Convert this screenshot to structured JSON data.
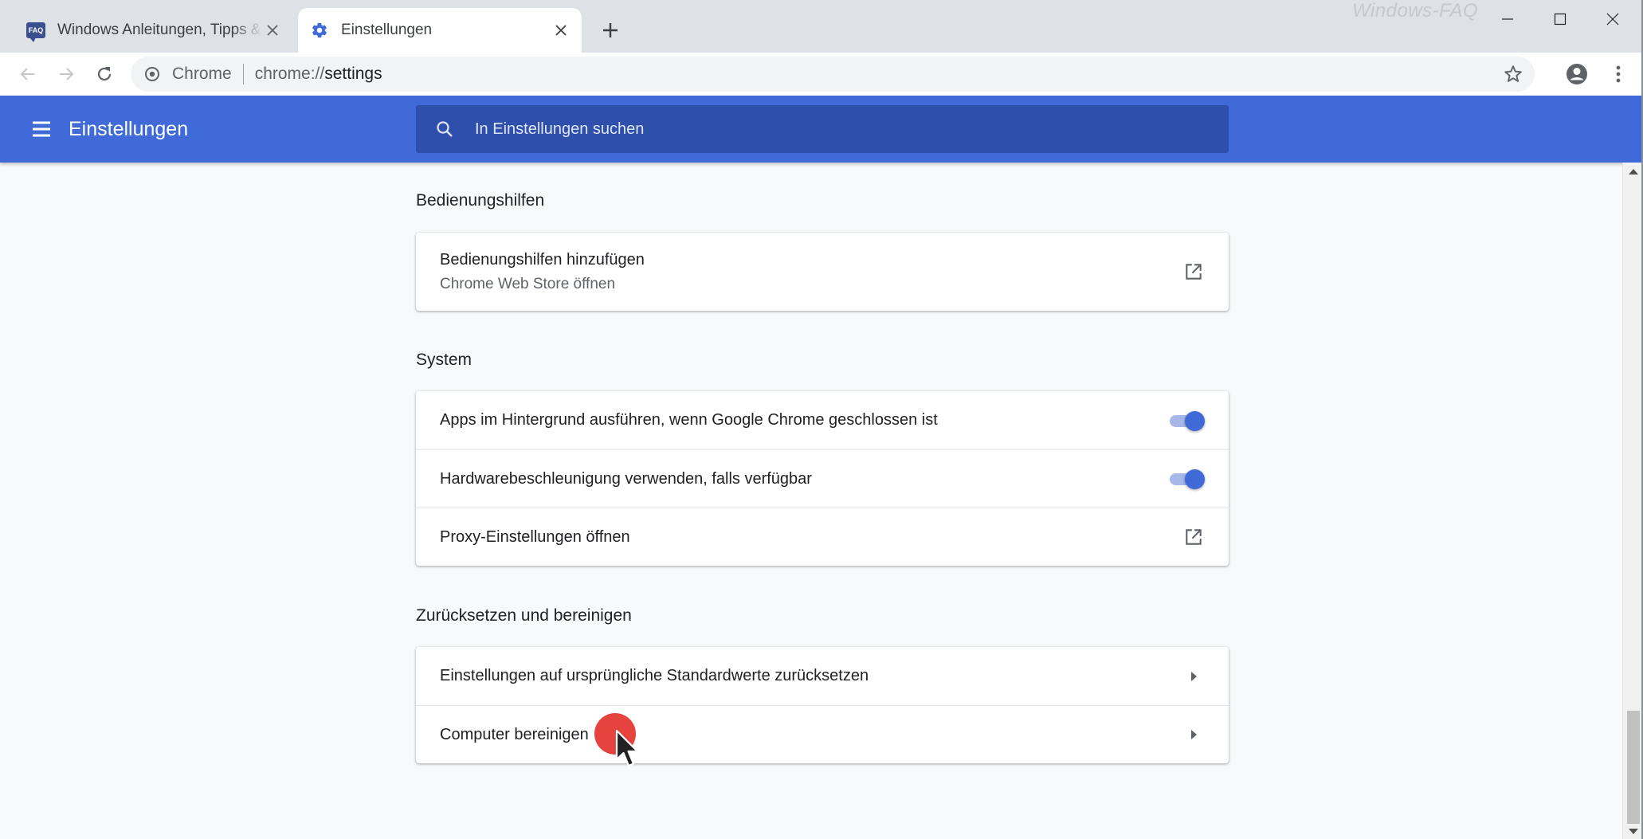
{
  "browser": {
    "tabs": [
      {
        "title": "Windows Anleitungen, Tipps & Tricks",
        "favicon": "faq-badge-icon",
        "favicon_text": "FAQ",
        "active": false
      },
      {
        "title": "Einstellungen",
        "favicon": "gear-icon",
        "active": true
      }
    ],
    "watermark": "Windows-FAQ",
    "omnibox": {
      "scheme_label": "Chrome",
      "url_prefix": "chrome://",
      "url_path": "settings"
    }
  },
  "header": {
    "title": "Einstellungen",
    "search_placeholder": "In Einstellungen suchen"
  },
  "sections": {
    "accessibility": {
      "title": "Bedienungshilfen",
      "rows": [
        {
          "label": "Bedienungshilfen hinzufügen",
          "sublabel": "Chrome Web Store öffnen",
          "control": "external-link-icon"
        }
      ]
    },
    "system": {
      "title": "System",
      "rows": [
        {
          "label": "Apps im Hintergrund ausführen, wenn Google Chrome geschlossen ist",
          "control": "toggle",
          "checked": true
        },
        {
          "label": "Hardwarebeschleunigung verwenden, falls verfügbar",
          "control": "toggle",
          "checked": true
        },
        {
          "label": "Proxy-Einstellungen öffnen",
          "control": "external-link-icon"
        }
      ]
    },
    "reset": {
      "title": "Zurücksetzen und bereinigen",
      "rows": [
        {
          "label": "Einstellungen auf ursprüngliche Standardwerte zurücksetzen",
          "control": "arrow-right-icon"
        },
        {
          "label": "Computer bereinigen",
          "control": "arrow-right-icon"
        }
      ]
    }
  },
  "colors": {
    "accent": "#3f6ad8",
    "search_bg": "#2f4fac",
    "page_bg": "#f8f9fa",
    "click_marker": "#e53935"
  }
}
